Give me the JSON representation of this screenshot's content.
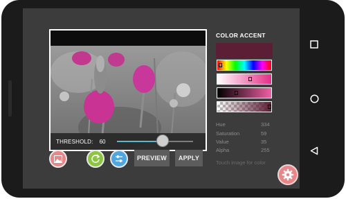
{
  "preview": {
    "threshold_label": "THRESHOLD:",
    "threshold_value": "60",
    "threshold_fraction": 0.6
  },
  "toolbar": {
    "preview_label": "PREVIEW",
    "apply_label": "APPLY",
    "icons": [
      "image-icon",
      "refresh-icon",
      "sliders-icon"
    ]
  },
  "panel": {
    "title": "COLOR ACCENT",
    "swatch_color": "#5b1e35",
    "stats": [
      {
        "label": "Hue",
        "value": "334"
      },
      {
        "label": "Saturation",
        "value": "59"
      },
      {
        "label": "Value",
        "value": "35"
      },
      {
        "label": "Alpha",
        "value": "255"
      }
    ],
    "hint": "Touch image for color"
  },
  "colors": {
    "accent_pink": "#e8878a",
    "accent_green": "#8cc63f",
    "accent_blue": "#4fa6e0",
    "button_gray": "#5c5c5c"
  }
}
